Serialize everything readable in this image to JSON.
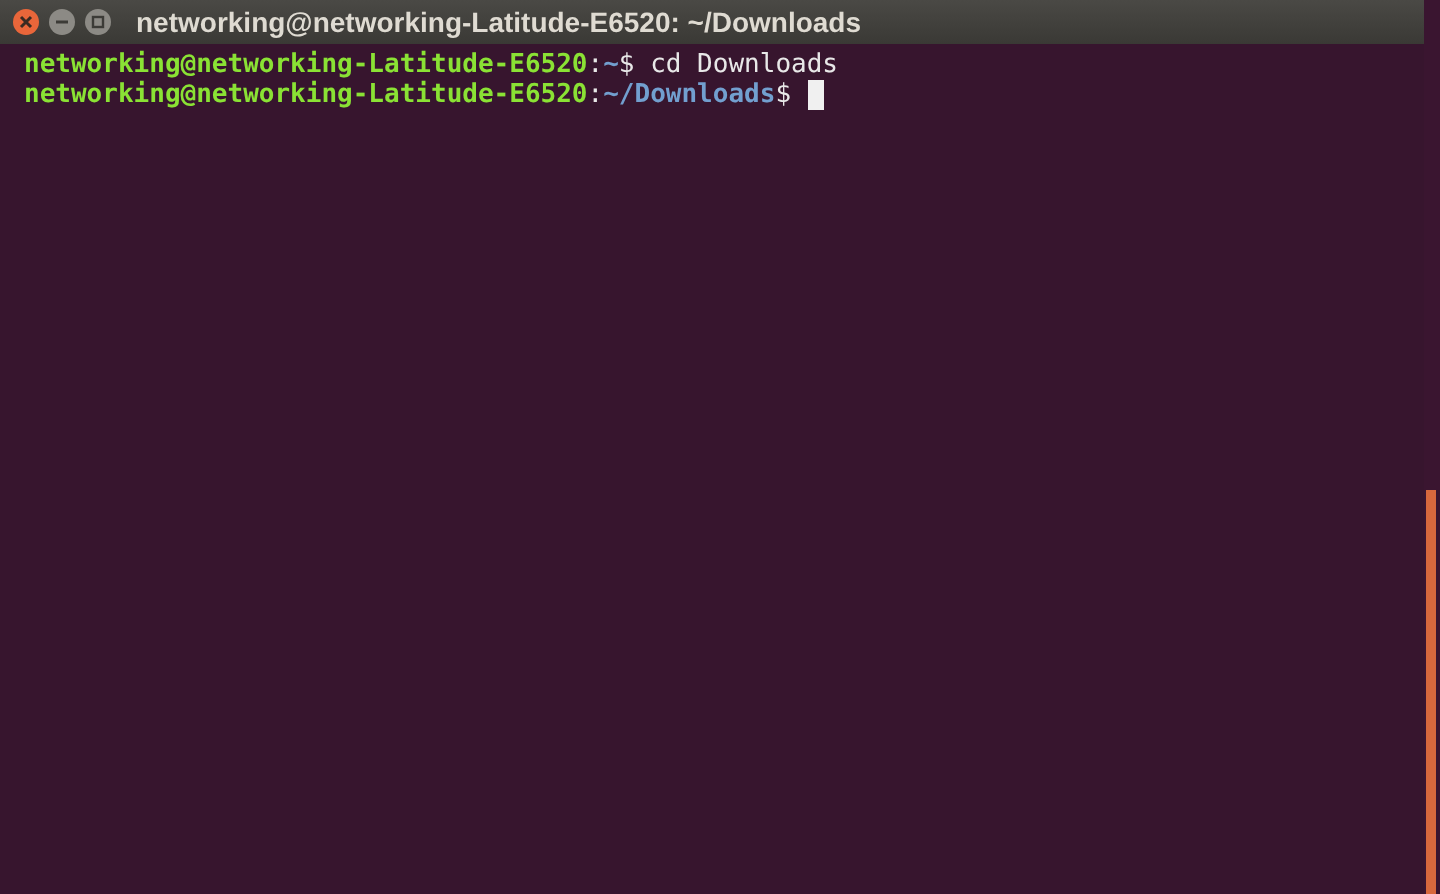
{
  "window": {
    "title": "networking@networking-Latitude-E6520: ~/Downloads"
  },
  "terminal": {
    "lines": [
      {
        "user_host": "networking@networking-Latitude-E6520",
        "separator": ":",
        "path": "~",
        "symbol": "$",
        "command": " cd Downloads",
        "cursor": false
      },
      {
        "user_host": "networking@networking-Latitude-E6520",
        "separator": ":",
        "path": "~/Downloads",
        "symbol": "$",
        "cursor": true
      }
    ]
  }
}
